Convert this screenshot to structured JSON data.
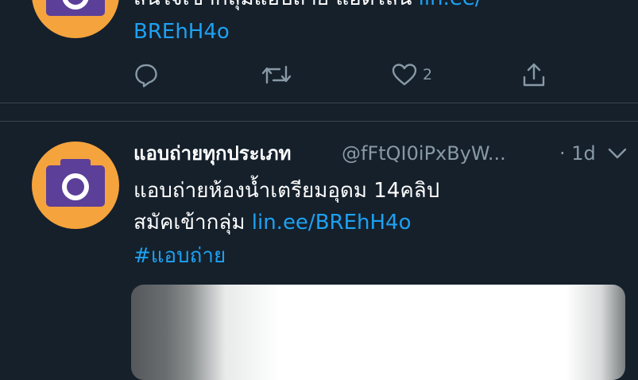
{
  "tweet_prev": {
    "text_line1": "สนใจเข้ากลุ่มแอบถ่าย แอดไลน์",
    "link_inline": "lin.ee/",
    "link_cont": "BREhH4o",
    "actions": {
      "like_count": "2"
    }
  },
  "tweet": {
    "display_name": "แอบถ่ายทุกประเภท",
    "handle": "@fFtQI0iPxByW...",
    "separator": "·",
    "time": "1d",
    "text_line1": "แอบถ่ายห้องน้ำเตรียมอุดม 14คลิป",
    "text_line2": "สมัคเข้ากลุ่ม",
    "link": "lin.ee/BREhH4o",
    "hashtag": "#แอบถ่าย"
  },
  "colors": {
    "background": "#15202b",
    "link": "#1da1f2",
    "muted": "#8899a6",
    "avatar": "#f5a33c",
    "camera_body": "#5b3f99"
  },
  "icons": [
    "camera-icon",
    "reply-icon",
    "retweet-icon",
    "heart-icon",
    "share-icon",
    "chevron-down-icon"
  ]
}
